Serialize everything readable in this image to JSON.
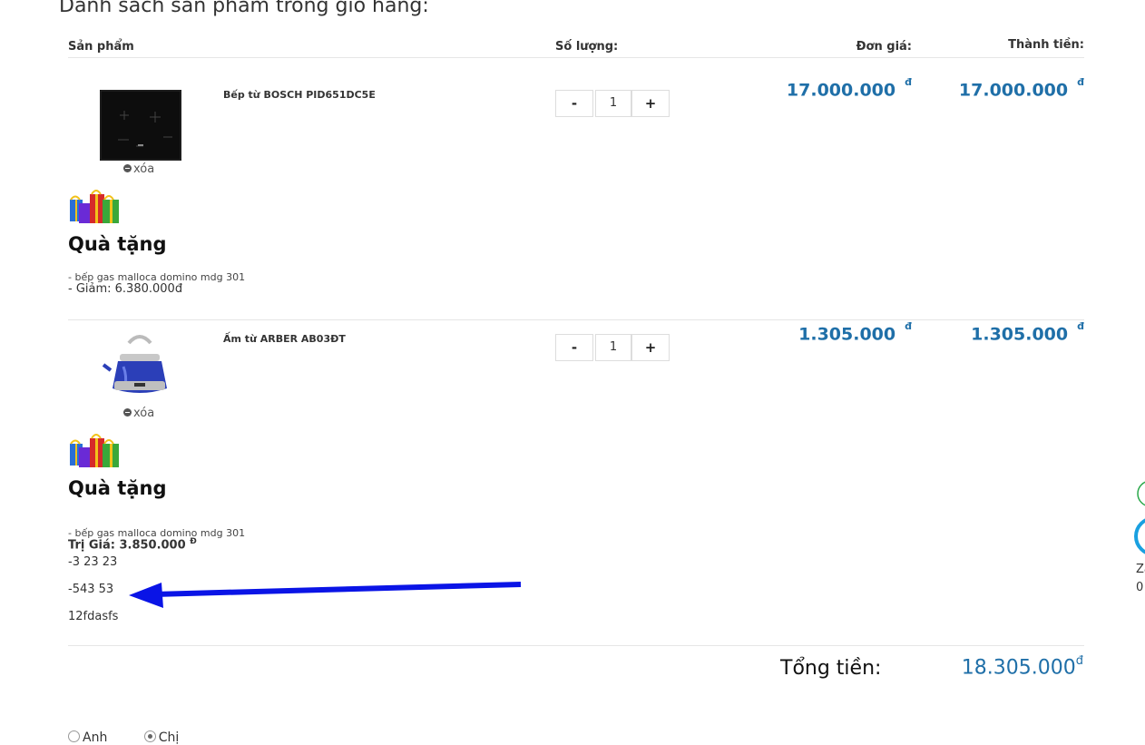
{
  "page_title": "Danh sách sản phẩm trong giỏ hàng:",
  "columns": {
    "product": "Sản phẩm",
    "quantity": "Số lượng:",
    "unit_price": "Đơn giá:",
    "subtotal": "Thành tiền:"
  },
  "items": [
    {
      "name": "Bếp từ BOSCH PID651DC5E",
      "remove_label": "xóa",
      "quantity": "1",
      "minus_label": "-",
      "plus_label": "+",
      "unit_price": "17.000.000",
      "subtotal": "17.000.000",
      "currency": "đ",
      "gift_title": "Quà tặng",
      "gift_line": "- bếp gas malloca domino mdg 301",
      "discount": "- Giảm: 6.380.000đ"
    },
    {
      "name": "Ấm từ ARBER AB03ĐT",
      "remove_label": "xóa",
      "quantity": "1",
      "minus_label": "-",
      "plus_label": "+",
      "unit_price": "1.305.000",
      "subtotal": "1.305.000",
      "currency": "đ",
      "gift_title": "Quà tặng",
      "gift_line": "- bếp gas malloca domino mdg 301",
      "value_label": "Trị Giá: 3.850.000",
      "value_currency": "Đ",
      "notes": [
        "-3 23 23",
        "-543 53",
        "12fdasfs"
      ]
    }
  ],
  "total": {
    "label": "Tổng tiền:",
    "value": "18.305.000",
    "currency": "đ"
  },
  "gender": {
    "options": [
      "Anh",
      "Chị"
    ],
    "selected": "Chị"
  },
  "side_widget": {
    "label_1": "Za",
    "label_2": "0"
  },
  "colors": {
    "price_blue": "#1f6fa8",
    "arrow_blue": "#0a14e6",
    "widget_green": "#2aa84a",
    "widget_blue": "#1aa0e0"
  }
}
